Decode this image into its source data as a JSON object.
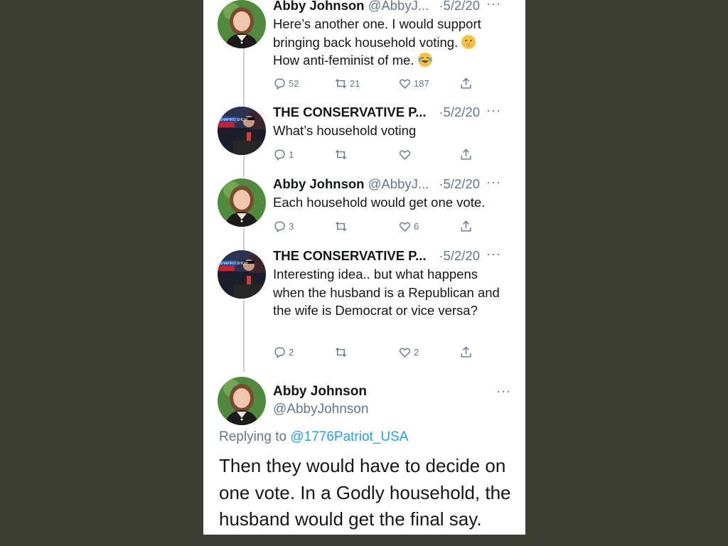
{
  "thread": [
    {
      "name": "Abby Johnson",
      "handle": "@AbbyJ...",
      "date": "·5/2/20",
      "more": "···",
      "avatar": "woman-portrait-avatar",
      "text_parts": [
        "Here’s another one. I would support bringing back household voting. ",
        " How anti-feminist of me. "
      ],
      "emojis": [
        "shushing-face-emoji",
        "laughing-tears-emoji"
      ],
      "actions": {
        "replies": "52",
        "retweets": "21",
        "likes": "187"
      }
    },
    {
      "name": "THE CONSERVATIVE P...",
      "handle": "",
      "date": "·5/2/20",
      "more": "···",
      "avatar": "shapiro-show-avatar",
      "text": "What’s household voting",
      "actions": {
        "replies": "1",
        "retweets": "",
        "likes": ""
      }
    },
    {
      "name": "Abby Johnson",
      "handle": "@AbbyJ...",
      "date": "·5/2/20",
      "more": "···",
      "avatar": "woman-portrait-avatar",
      "text": "Each household would get one vote.",
      "actions": {
        "replies": "3",
        "retweets": "",
        "likes": "6"
      }
    },
    {
      "name": "THE CONSERVATIVE P...",
      "handle": "",
      "date": "·5/2/20",
      "more": "···",
      "avatar": "shapiro-show-avatar",
      "text": "Interesting idea.. but what happens when the husband is a Republican and the wife is Democrat or vice versa?",
      "actions": {
        "replies": "2",
        "retweets": "",
        "likes": "2"
      }
    }
  ],
  "main_tweet": {
    "name": "Abby Johnson",
    "handle": "@AbbyJohnson",
    "more": "···",
    "replying_prefix": "Replying to ",
    "replying_to": "@1776Patriot_USA",
    "text": "Then they would have to decide on one vote. In a Godly household, the husband would get the final say."
  },
  "avatar_badge_text": "SHAPIRO SHOW",
  "colors": {
    "background": "#3b3d30",
    "panel": "#ffffff",
    "text": "#14171a",
    "muted": "#657786",
    "link": "#1da1f2",
    "thread_line": "#c9d1d8"
  }
}
